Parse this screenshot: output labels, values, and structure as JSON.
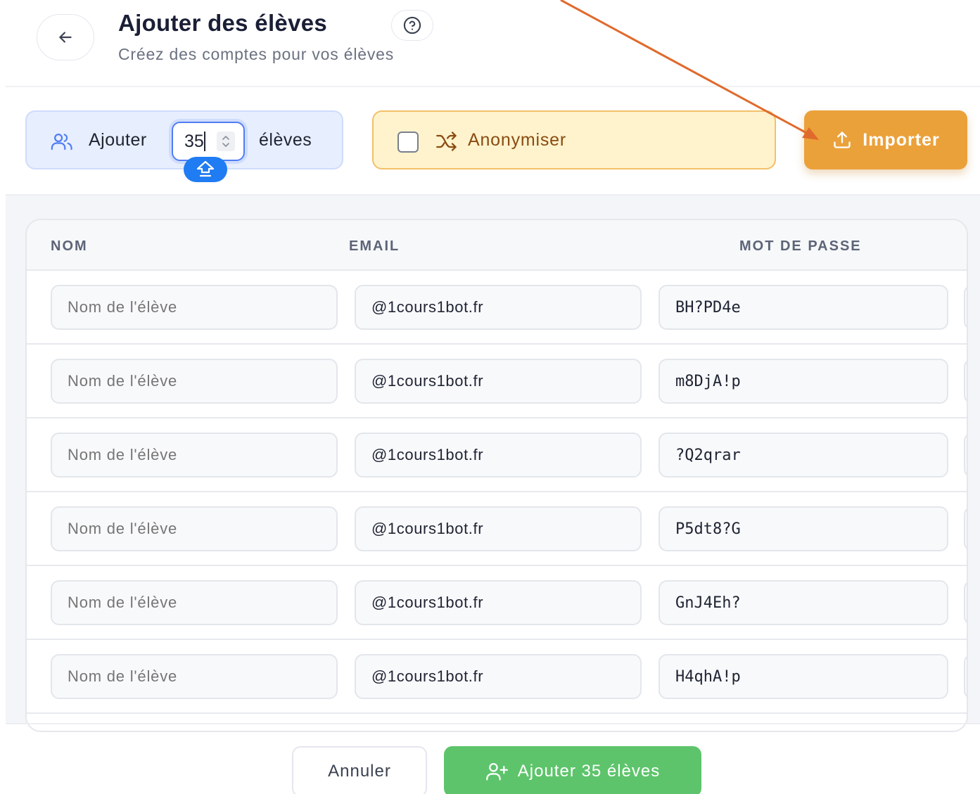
{
  "header": {
    "title": "Ajouter des élèves",
    "subtitle": "Créez des comptes pour vos élèves",
    "back_icon": "arrow-left-icon",
    "help_icon": "help-circle-icon"
  },
  "toolbar": {
    "add_label": "Ajouter",
    "count_value": "35",
    "unit_label": "élèves",
    "users_icon": "users-icon",
    "anonymize_label": "Anonymiser",
    "anonymize_checked": false,
    "shuffle_icon": "shuffle-icon",
    "import_label": "Importer",
    "upload_icon": "upload-icon",
    "keyboard_badge_icon": "shift-key-icon"
  },
  "table": {
    "columns": [
      "NOM",
      "EMAIL",
      "MOT DE PASSE"
    ],
    "rows": [
      {
        "name_placeholder": "Nom de l'élève",
        "email": "@1cours1bot.fr",
        "password": "BH?PD4e"
      },
      {
        "name_placeholder": "Nom de l'élève",
        "email": "@1cours1bot.fr",
        "password": "m8DjA!p"
      },
      {
        "name_placeholder": "Nom de l'élève",
        "email": "@1cours1bot.fr",
        "password": "?Q2qrar"
      },
      {
        "name_placeholder": "Nom de l'élève",
        "email": "@1cours1bot.fr",
        "password": "P5dt8?G"
      },
      {
        "name_placeholder": "Nom de l'élève",
        "email": "@1cours1bot.fr",
        "password": "GnJ4Eh?"
      },
      {
        "name_placeholder": "Nom de l'élève",
        "email": "@1cours1bot.fr",
        "password": "H4qhA!p"
      }
    ]
  },
  "footer": {
    "cancel_label": "Annuler",
    "submit_label": "Ajouter 35 élèves",
    "submit_icon": "user-plus-icon"
  },
  "colors": {
    "accent_blue": "#4f7df3",
    "import_orange": "#eba13a",
    "annotation_arrow": "#e06a2c",
    "submit_green": "#5dc46b",
    "anonymize_bg": "#fef3cd"
  }
}
